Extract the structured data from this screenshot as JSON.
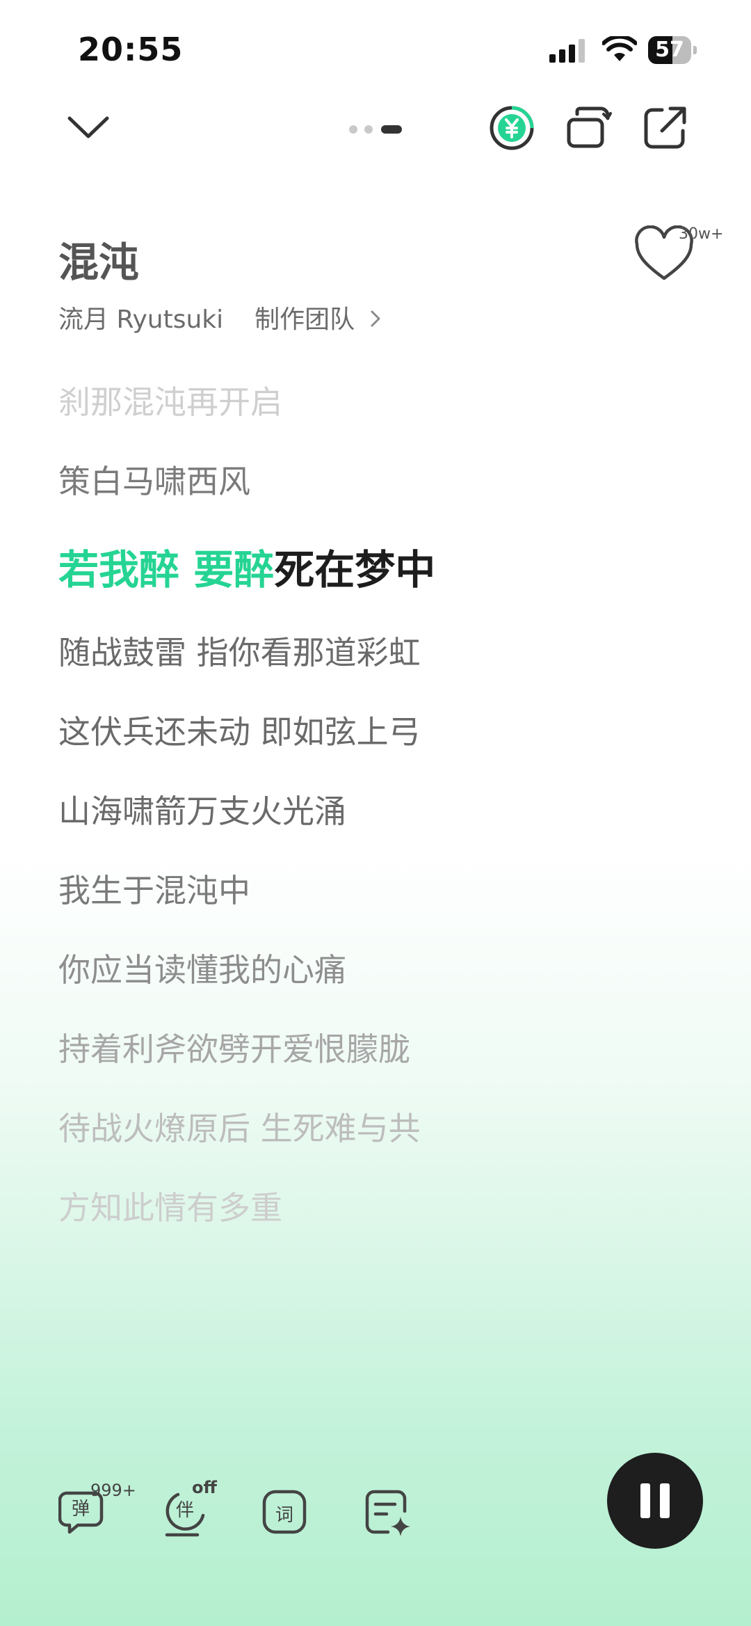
{
  "status_bar": {
    "time": "20:55",
    "battery": "57",
    "battery_level": 0.57
  },
  "icons": {
    "collapse": "chevron-down-icon",
    "vip": "yen-coin-icon",
    "switch": "switch-view-icon",
    "share": "share-icon",
    "like": "heart-icon",
    "danmaku": "danmaku-icon",
    "accompany": "accompany-icon",
    "lyrics_mode": "lyrics-word-icon",
    "lyrics_edit": "lyrics-sparkle-icon",
    "pause": "pause-icon"
  },
  "song": {
    "title": "混沌",
    "artist": "流月 Ryutsuki",
    "team": "制作团队",
    "likes": "30w+"
  },
  "lyrics": {
    "prev": [
      "刹那混沌再开启",
      "策白马啸西风"
    ],
    "current_done": "若我醉 要醉",
    "current_rest": "死在梦中",
    "next": [
      "随战鼓雷 指你看那道彩虹",
      "这伏兵还未动 即如弦上弓",
      "山海啸箭万支火光涌",
      "我生于混沌中",
      "你应当读懂我的心痛",
      "持着利斧欲劈开爱恨朦胧",
      "待战火燎原后 生死难与共",
      "方知此情有多重"
    ]
  },
  "bottom": {
    "danmaku_label": "弹",
    "danmaku_count": "999+",
    "accompany_label": "伴",
    "accompany_state": "off",
    "lyrics_label": "词"
  },
  "colors": {
    "accent": "#25d493",
    "play_button": "#1e1e1e"
  }
}
